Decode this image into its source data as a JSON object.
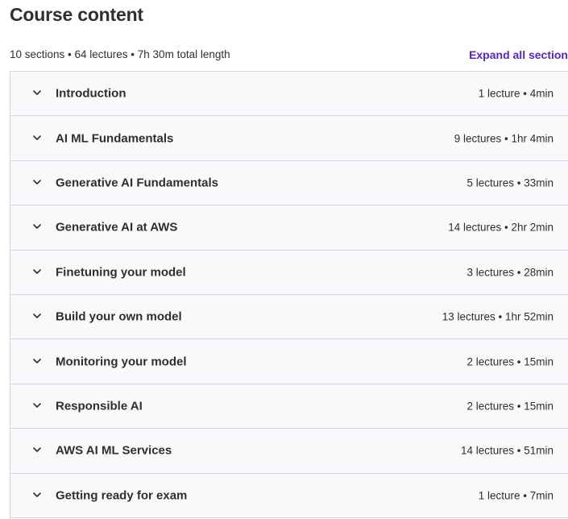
{
  "header": {
    "title": "Course content",
    "summary": "10 sections • 64 lectures • 7h 30m total length",
    "expand_all_label": "Expand all section"
  },
  "icons": {
    "section_toggle": "chevron-down-icon"
  },
  "colors": {
    "accent": "#5624d0",
    "section_background": "#f7f9fa",
    "border": "#d1d7dc",
    "text": "#2d2f31"
  },
  "sections": [
    {
      "title": "Introduction",
      "meta": "1 lecture • 4min"
    },
    {
      "title": "AI ML Fundamentals",
      "meta": "9 lectures • 1hr 4min"
    },
    {
      "title": "Generative AI Fundamentals",
      "meta": "5 lectures • 33min"
    },
    {
      "title": "Generative AI at AWS",
      "meta": "14 lectures • 2hr 2min"
    },
    {
      "title": "Finetuning your model",
      "meta": "3 lectures • 28min"
    },
    {
      "title": "Build your own model",
      "meta": "13 lectures • 1hr 52min"
    },
    {
      "title": "Monitoring your model",
      "meta": "2 lectures • 15min"
    },
    {
      "title": "Responsible AI",
      "meta": "2 lectures • 15min"
    },
    {
      "title": "AWS AI ML Services",
      "meta": "14 lectures • 51min"
    },
    {
      "title": "Getting ready for exam",
      "meta": "1 lecture • 7min"
    }
  ]
}
